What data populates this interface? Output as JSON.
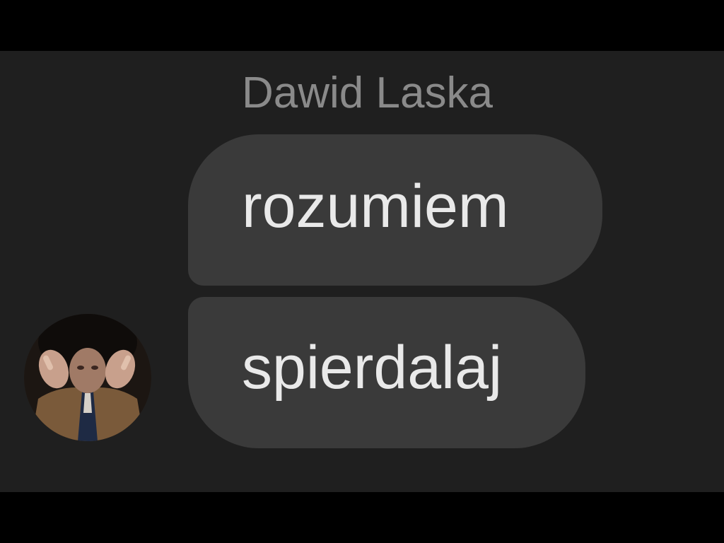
{
  "conversation": {
    "sender_name": "Dawid Laska",
    "messages": [
      {
        "text": "rozumiem"
      },
      {
        "text": "spierdalaj"
      }
    ]
  },
  "colors": {
    "background": "#1f1f1f",
    "bubble": "#3a3a3a",
    "message_text": "#e9e9e9",
    "name_text": "#8a8a8a"
  }
}
